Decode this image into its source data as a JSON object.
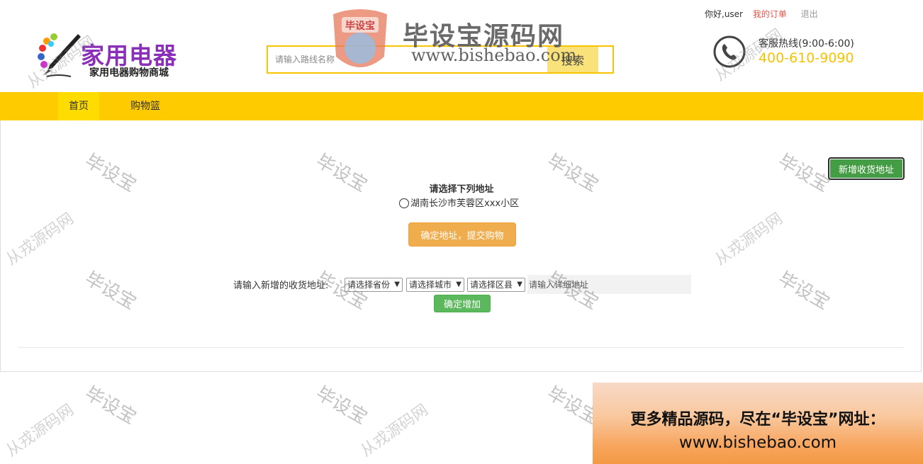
{
  "header": {
    "logo_title": "家用电器",
    "logo_subtitle": "家用电器购物商城",
    "search_placeholder": "请输入路线名称",
    "search_button": "搜索",
    "greeting": "你好,user",
    "my_orders": "我的订单",
    "logout": "退出",
    "hotline_label": "客服热线(9:00-6:00)",
    "hotline_number": "400-610-9090"
  },
  "nav": {
    "items": [
      {
        "label": "首页",
        "active": true
      },
      {
        "label": "购物篮",
        "active": false
      }
    ]
  },
  "address": {
    "add_button": "新增收货地址",
    "choose_title": "请选择下列地址",
    "options": [
      "湖南长沙市芙蓉区xxx小区"
    ],
    "confirm_submit": "确定地址，提交购物",
    "new_label": "请输入新增的收货地址:",
    "province_placeholder": "请选择省份",
    "city_placeholder": "请选择城市",
    "county_placeholder": "请选择区县",
    "detail_placeholder": "请输入详细地址",
    "confirm_add": "确定增加"
  },
  "watermark": {
    "logo_text": "毕设宝",
    "title": "毕设宝源码网",
    "url": "www.bishebao.com",
    "small": "毕设宝",
    "diagonal": "从戎源码网"
  },
  "promo": {
    "line1": "更多精品源码，尽在“毕设宝”网址：",
    "line2": "www.bishebao.com"
  },
  "colors": {
    "nav_bg": "#fdcb00",
    "accent_yellow": "#f4c400",
    "add_button_green": "#449d44",
    "confirm_orange": "#f0ad4e",
    "confirm_add_green": "#5cb85c"
  }
}
